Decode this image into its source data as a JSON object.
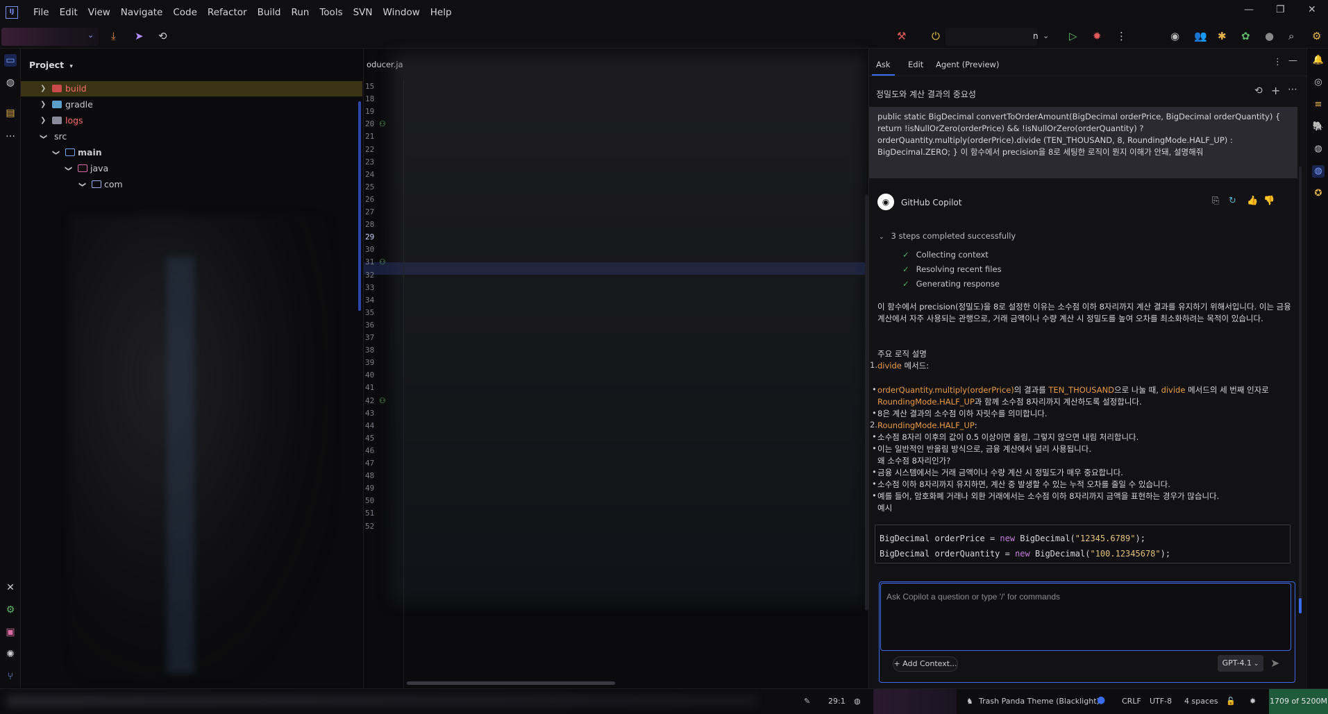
{
  "menu": [
    "File",
    "Edit",
    "View",
    "Navigate",
    "Code",
    "Refactor",
    "Build",
    "Run",
    "Tools",
    "SVN",
    "Window",
    "Help"
  ],
  "toolbar": {
    "run_config_suffix": "n"
  },
  "project": {
    "header": "Project",
    "tree": [
      {
        "label": "build",
        "color": "#ff6b6b"
      },
      {
        "label": "gradle",
        "color": "#d4d4d8"
      },
      {
        "label": "logs",
        "color": "#ff6b6b"
      },
      {
        "label": "src",
        "color": "#d4d4d8"
      },
      {
        "label": "main",
        "color": "#e6e6ea"
      },
      {
        "label": "java",
        "color": "#d4d4d8"
      },
      {
        "label": "com",
        "color": "#d4d4d8"
      }
    ]
  },
  "editor": {
    "tab": "oducer.ja",
    "lines": [
      "15",
      "18",
      "19",
      "20",
      "21",
      "22",
      "23",
      "24",
      "25",
      "26",
      "27",
      "28",
      "29",
      "30",
      "31",
      "32",
      "33",
      "34",
      "35",
      "36",
      "37",
      "38",
      "39",
      "40",
      "41",
      "42",
      "43",
      "44",
      "45",
      "46",
      "47",
      "48",
      "49",
      "50",
      "51",
      "52"
    ],
    "current_line": "29"
  },
  "copilot": {
    "tabs": [
      "Ask",
      "Edit",
      "Agent (Preview)"
    ],
    "title": "정밀도와 계산 결과의 중요성",
    "user_message": "public static BigDecimal convertToOrderAmount(BigDecimal orderPrice, BigDecimal orderQuantity) { return !isNullOrZero(orderPrice) && !isNullOrZero(orderQuantity) ? orderQuantity.multiply(orderPrice).divide (TEN_THOUSAND, 8, RoundingMode.HALF_UP) : BigDecimal.ZERO; } 이 함수에서 precision을 8로 세팅한 로직이 뭔지 이해가 안돼, 설명해줘",
    "responder": "GitHub Copilot",
    "steps_title": "3 steps completed successfully",
    "steps": [
      "Collecting context",
      "Resolving recent files",
      "Generating response"
    ],
    "para1": "이 함수에서 precision(정밀도)을 8로 설정한 이유는 소수점 이하 8자리까지 계산 결과를 유지하기 위해서입니다. 이는 금융 계산에서 자주 사용되는 관행으로, 거래 금액이나 수량 계산 시 정밀도를 높여 오차를 최소화하려는 목적이 있습니다.",
    "section_title": "주요 로직 설명",
    "item1_code": "divide",
    "item1_rest": " 메서드:",
    "b1_code1": "orderQuantity.multiply(orderPrice)",
    "b1_t1": "의 결과를 ",
    "b1_code2": "TEN_THOUSAND",
    "b1_t2": "으로 나눌 때, ",
    "b1_code3": "divide",
    "b1_t3": " 메서드의 세 번째 인자로",
    "b1_code4": "RoundingMode.HALF_UP",
    "b1_t4": "과 함께 소수점 8자리까지 계산하도록 설정합니다.",
    "b2": "8은 계산 결과의 소수점 이하 자릿수를 의미합니다.",
    "item2_code": "RoundingMode.HALF_UP",
    "item2_rest": ":",
    "b3": "소수점 8자리 이후의 값이 0.5 이상이면 올림, 그렇지 않으면 내림 처리합니다.",
    "b4": "이는 일반적인 반올림 방식으로, 금융 계산에서 널리 사용됩니다.",
    "q": "왜 소수점 8자리인가?",
    "b5": "금융 시스템에서는 거래 금액이나 수량 계산 시 정밀도가 매우 중요합니다.",
    "b6": "소수점 이하 8자리까지 유지하면, 계산 중 발생할 수 있는 누적 오차를 줄일 수 있습니다.",
    "b7": "예를 들어, 암호화폐 거래나 외환 거래에서는 소수점 이하 8자리까지 금액을 표현하는 경우가 많습니다.",
    "example_label": "예시",
    "code_line1_a": "BigDecimal orderPrice = ",
    "code_kw": "new",
    "code_line1_b": " BigDecimal(",
    "code_line1_str": "\"12345.6789\"",
    "code_line1_c": ");",
    "code_line2_a": "BigDecimal orderQuantity = ",
    "code_line2_b": " BigDecimal(",
    "code_line2_str": "\"100.12345678\"",
    "code_line2_c": ");",
    "input_placeholder": "Ask Copilot a question or type '/' for commands",
    "add_context": "Add Context...",
    "model": "GPT-4.1"
  },
  "status": {
    "position": "29:1",
    "theme": "Trash Panda Theme (Blacklight)",
    "line_sep": "CRLF",
    "encoding": "UTF-8",
    "indent": "4 spaces",
    "memory": "1709 of 5200M"
  },
  "colors": {
    "accent": "#3b6cf0",
    "error": "#ff6b6b",
    "success": "#4fb06a",
    "memory_bg": "#1f5a3a"
  }
}
